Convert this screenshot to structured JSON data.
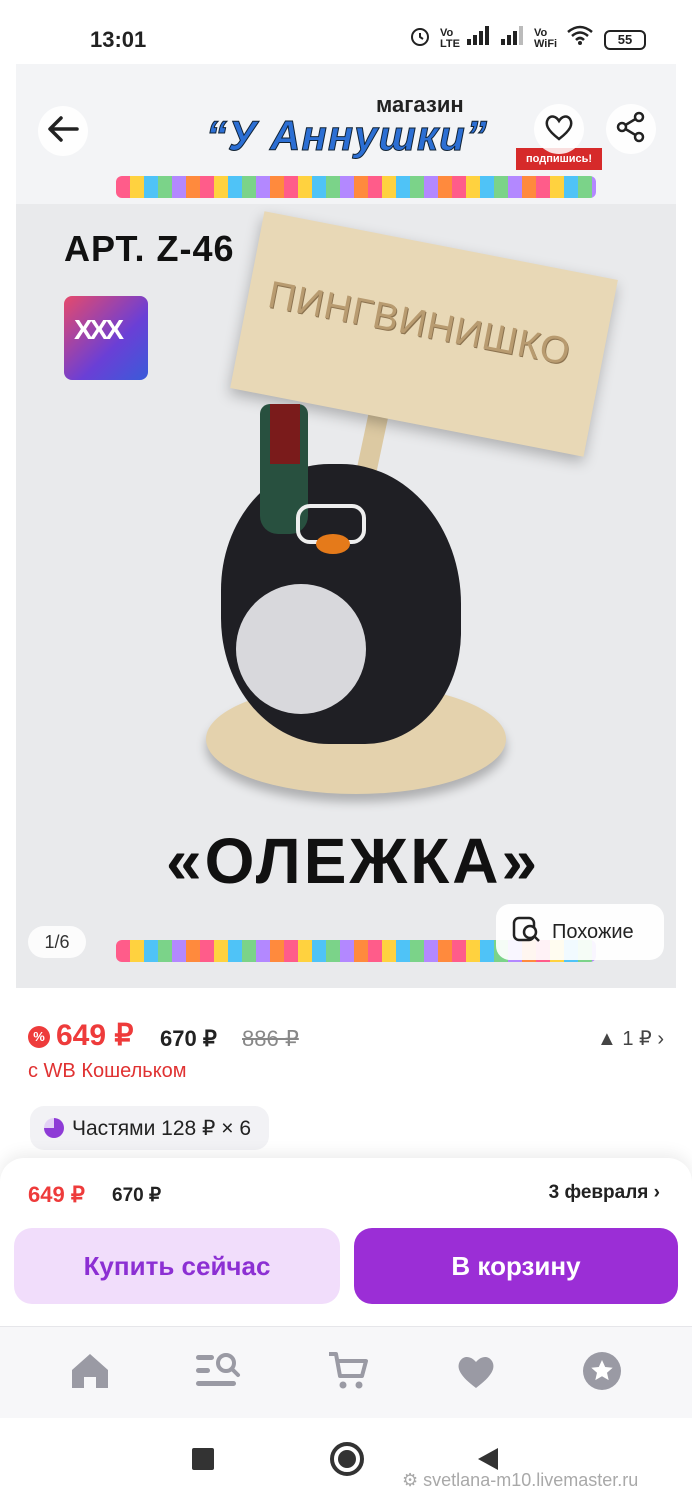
{
  "status_bar": {
    "time": "13:01",
    "battery": "55",
    "icons": [
      "alarm-icon",
      "volte-icon",
      "signal-icon",
      "signal-icon",
      "vowifi-icon",
      "wifi-icon",
      "battery-icon"
    ]
  },
  "gallery": {
    "shop_small": "магазин",
    "shop_name": "“У Аннушки”",
    "subscribe": "подпишись!",
    "art": "АРТ. Z-46",
    "sign_text": "ПИНГВИНИШКО",
    "product_name": "«ОЛЕЖКА»",
    "counter": "1/6",
    "similar_label": "Похожие",
    "back_icon": "arrow-left-icon",
    "fav_icon": "heart-outline-icon",
    "share_icon": "share-icon"
  },
  "price": {
    "main": "649 ₽",
    "old1": "670 ₽",
    "old2": "886 ₽",
    "drop": "▲ 1 ₽ ›",
    "wallet_text": "с WB Кошельком",
    "installments": "Частями 128 ₽ × 6"
  },
  "buy_panel": {
    "price": "649 ₽",
    "old": "670 ₽",
    "date": "3 февраля ›",
    "buy_now": "Купить сейчас",
    "add_to_cart": "В корзину"
  },
  "bottom_nav": [
    "home-icon",
    "catalog-search-icon",
    "cart-icon",
    "favorites-heart-icon",
    "profile-star-icon"
  ],
  "watermark": "svetlana-m10.livemaster.ru",
  "colors": {
    "accent": "#9b2ed6",
    "accent_light": "#f1ddfb",
    "price_red": "#ee3b3b"
  }
}
